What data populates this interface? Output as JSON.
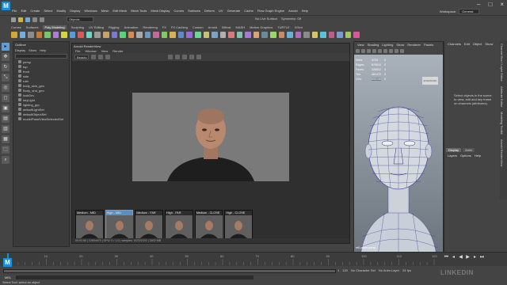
{
  "app": {
    "logo": "M",
    "badge": "M"
  },
  "menubar": {
    "items": [
      "File",
      "Edit",
      "Create",
      "Select",
      "Modify",
      "Display",
      "Windows",
      "Mesh",
      "Edit Mesh",
      "Mesh Tools",
      "Mesh Display",
      "Curves",
      "Surfaces",
      "Deform",
      "UV",
      "Generate",
      "Cache",
      "Flow Graph Engine",
      "Arnold",
      "Help"
    ],
    "workspace_label": "Workspace:",
    "workspace_value": "General"
  },
  "statusline": {
    "object_mode": "Objects",
    "live_surface": "No Live Surface",
    "symmetry": "Symmetry: Off"
  },
  "shelf": {
    "tabs": [
      "Curves",
      "Surfaces",
      "Poly Modeling",
      "Sculpting",
      "UV Editing",
      "Rigging",
      "Animation",
      "Rendering",
      "FX",
      "FX Caching",
      "Custom",
      "Arnold",
      "Bifrost",
      "MASH",
      "Motion Graphics",
      "TURTLE",
      "XGen"
    ],
    "active_tab": "Poly Modeling",
    "icon_colors": [
      "#d6a53a",
      "#6fb0e0",
      "#8c8c8c",
      "#c47a3a",
      "#7ac46a",
      "#b07ad6",
      "#d6d63a",
      "#5a9ad6",
      "#d65a5a",
      "#6ad6c4",
      "#9a9a9a",
      "#c4a46a",
      "#7a7ad6",
      "#5ad67a",
      "#d68a5a",
      "#aaaaaa",
      "#6a9ac4",
      "#c46a9a",
      "#8ac46a",
      "#d6b05a",
      "#5a8ad6",
      "#9a6ad6",
      "#6ad69a",
      "#c4c46a",
      "#7aa4c4",
      "#b0b0b0",
      "#d67a7a",
      "#7ac4b0",
      "#a47ad6",
      "#d6a47a",
      "#6a8a9a",
      "#9ad66a",
      "#c48a6a",
      "#6ab0d6",
      "#b06ac4",
      "#8a8a8a",
      "#d6c46a",
      "#5ac4d6",
      "#c45a8a",
      "#7a9ad6",
      "#a4c46a",
      "#d65a9a"
    ]
  },
  "toolbox": {
    "tools": [
      "▸",
      "✥",
      "↻",
      "⤡",
      "◎",
      "◻",
      "▣",
      "▤",
      "▥",
      "▦",
      "⬚",
      "⌕"
    ]
  },
  "outliner": {
    "title": "Outliner",
    "menu": [
      "Display",
      "Show",
      "Help"
    ],
    "items": [
      {
        "label": "persp"
      },
      {
        "label": "top"
      },
      {
        "label": "front"
      },
      {
        "label": "side"
      },
      {
        "label": "ruth"
      },
      {
        "label": "body_skin_geo"
      },
      {
        "label": "Body_shd_geo"
      },
      {
        "label": "lookDev"
      },
      {
        "label": "keyLight"
      },
      {
        "label": "lighting_grp"
      },
      {
        "label": "defaultLightSet"
      },
      {
        "label": "defaultObjectSet"
      },
      {
        "label": "modelPanelViewSelectedSet"
      }
    ]
  },
  "renderview": {
    "title": "Arnold RenderView",
    "menu": [
      "File",
      "Window",
      "View",
      "Render"
    ],
    "camera": "Beauty",
    "thumbnails": [
      {
        "label": "Medium - MID",
        "active": false
      },
      {
        "label": "High - MID",
        "active": true
      },
      {
        "label": "Medium - FAR",
        "active": false
      },
      {
        "label": "High - FAR",
        "active": false
      },
      {
        "label": "Medium - CLOSE",
        "active": false
      },
      {
        "label": "High - CLOSE",
        "active": false
      }
    ],
    "status": "00:01:50 | 1280x670 | GPU: 0 / 1.0 | samples: 3/2/2/2/2/2 | 3402 MB"
  },
  "viewport": {
    "menu": [
      "View",
      "Shading",
      "Lighting",
      "Show",
      "Renderer",
      "Panels"
    ],
    "hud": {
      "rows": [
        {
          "label": "Verts:",
          "a": "4734",
          "b": "0",
          "hl": false
        },
        {
          "label": "Edges:",
          "a": "679510",
          "b": "0",
          "hl": false
        },
        {
          "label": "Faces:",
          "a": "226512",
          "b": "0",
          "hl": false
        },
        {
          "label": "Tris:",
          "a": "481472",
          "b": "0",
          "hl": false
        },
        {
          "label": "UVs:",
          "a": "695196",
          "b": "0",
          "hl": true
        }
      ],
      "badge": "ENHANCED"
    },
    "camera": "refLoader:persp"
  },
  "channelbox": {
    "menu": [
      "Channels",
      "Edit",
      "Object",
      "Show"
    ],
    "message": "Select objects in the scene to view, edit and key frame on channels (attributes).",
    "layer_tabs": [
      "Display",
      "Anim"
    ],
    "layer_menu": [
      "Layers",
      "Options",
      "Help"
    ],
    "side_tabs": [
      "Channel Box / Layer Editor",
      "Attribute Editor",
      "Modeling Toolkit",
      "Arnold RenderView"
    ]
  },
  "timeline": {
    "ticks": [
      "10",
      "20",
      "30",
      "40",
      "50",
      "60",
      "70",
      "80",
      "90",
      "100",
      "110",
      "120"
    ],
    "current_frame": "1"
  },
  "range": {
    "start": "1",
    "end": "120",
    "char_set": "No Character Set",
    "anim_layer": "No Anim Layer",
    "fps": "24 fps"
  },
  "cmdline": {
    "mel": "MEL"
  },
  "help": {
    "text": "Select Tool: select an object"
  },
  "watermark": "LINKEDIN"
}
